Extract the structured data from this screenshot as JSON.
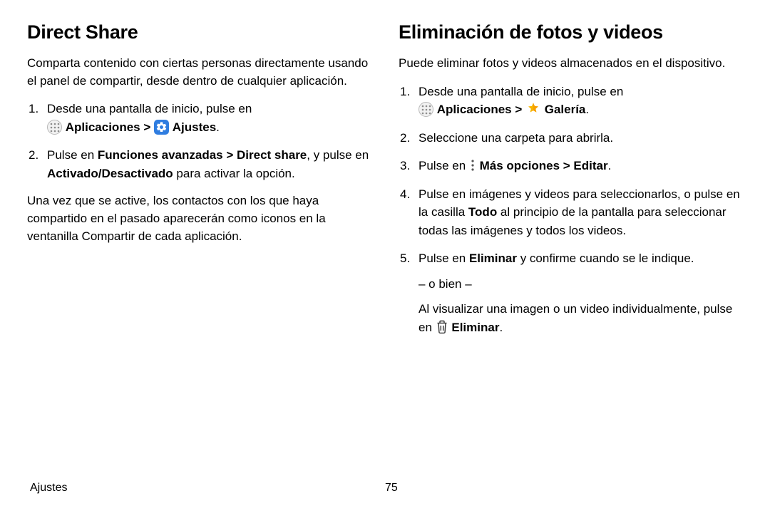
{
  "left": {
    "heading": "Direct Share",
    "intro": "Comparta contenido con ciertas personas directamente usando el panel de compartir, desde dentro de cualquier aplicación.",
    "step1_lead": "Desde una pantalla de inicio, pulse en ",
    "step1_apps": "Aplicaciones",
    "step1_gt": " > ",
    "step1_settings": "Ajustes",
    "step1_period": ".",
    "step2_a": "Pulse en ",
    "step2_b": "Funciones avanzadas > Direct share",
    "step2_c": ", y pulse en ",
    "step2_d": "Activado/Desactivado",
    "step2_e": " para activar la opción.",
    "outro": "Una vez que se active, los contactos con los que haya compartido en el pasado aparecerán como iconos en la ventanilla Compartir de cada aplicación."
  },
  "right": {
    "heading": "Eliminación de fotos y videos",
    "intro": "Puede eliminar fotos y videos almacenados en el dispositivo.",
    "step1_lead": "Desde una pantalla de inicio, pulse en ",
    "step1_apps": "Aplicaciones",
    "step1_gt": " > ",
    "step1_gallery": "Galería",
    "step1_period": ".",
    "step2": "Seleccione una carpeta para abrirla.",
    "step3_a": "Pulse en ",
    "step3_b": "Más opciones > Editar",
    "step3_c": ".",
    "step4_a": "Pulse en imágenes y videos para seleccionarlos, o pulse en la casilla ",
    "step4_b": "Todo",
    "step4_c": " al principio de la pantalla para seleccionar todas las imágenes y todos los videos.",
    "step5_a": "Pulse en ",
    "step5_b": "Eliminar",
    "step5_c": " y confirme cuando se le indique.",
    "step5_or": "– o bien –",
    "step5_d": "Al visualizar una imagen o un video individualmente, pulse en ",
    "step5_e": "Eliminar",
    "step5_f": "."
  },
  "footer": {
    "section": "Ajustes",
    "page": "75"
  }
}
